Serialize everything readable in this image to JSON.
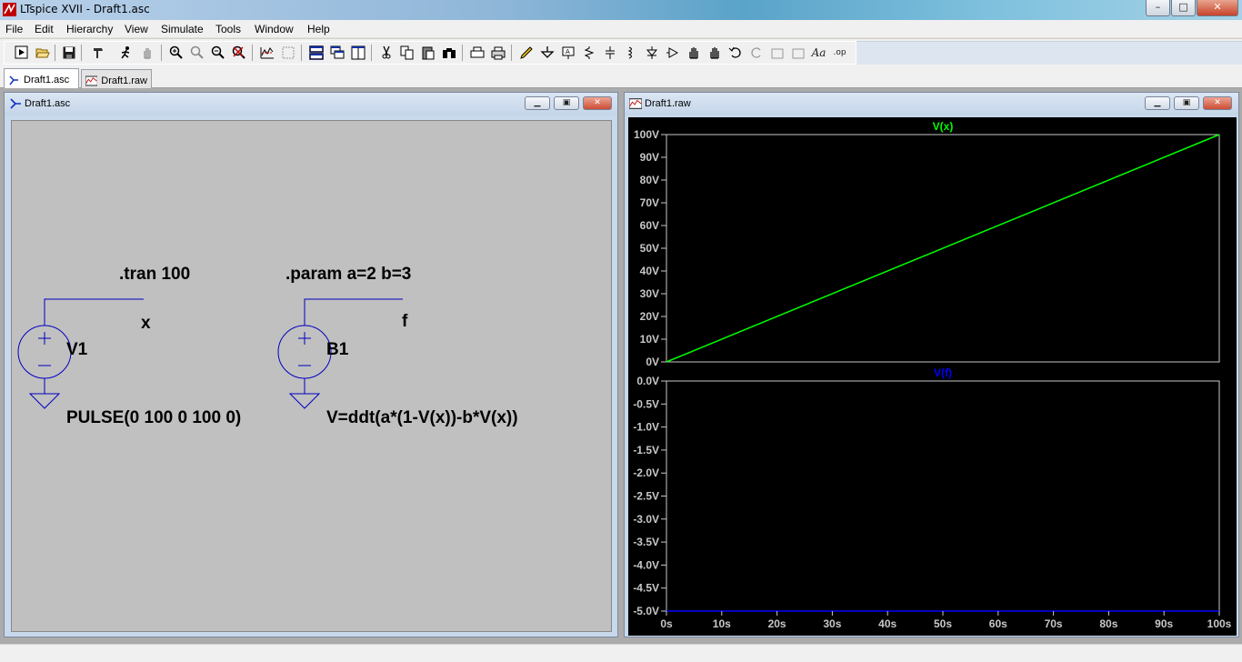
{
  "window": {
    "title": "LTspice XVII - Draft1.asc",
    "min": "–",
    "max": "□",
    "close": "✕"
  },
  "menu": [
    "File",
    "Edit",
    "Hierarchy",
    "View",
    "Simulate",
    "Tools",
    "Window",
    "Help"
  ],
  "tabs": [
    {
      "label": "Draft1.asc",
      "icon": "schematic-icon",
      "active": true
    },
    {
      "label": "Draft1.raw",
      "icon": "waveform-icon",
      "active": false
    }
  ],
  "schematic": {
    "title": "Draft1.asc",
    "directives": {
      "tran": ".tran 100",
      "param": ".param a=2 b=3"
    },
    "v1": {
      "name": "V1",
      "value": "PULSE(0 100 0 100 0)",
      "net": "x"
    },
    "b1": {
      "name": "B1",
      "value": "V=ddt(a*(1-V(x))-b*V(x))",
      "net": "f"
    }
  },
  "waveform": {
    "title": "Draft1.raw",
    "colors": {
      "vx": "#00ff00",
      "vf": "#0000ff",
      "axis": "#c8c8c8",
      "text": "#c8c8c8"
    }
  },
  "chart_data": [
    {
      "type": "line",
      "title": "V(x)",
      "xlabel": "",
      "ylabel": "",
      "x": [
        0,
        100
      ],
      "series": [
        {
          "name": "V(x)",
          "values": [
            0,
            100
          ]
        }
      ],
      "xlim": [
        0,
        100
      ],
      "ylim": [
        0,
        100
      ],
      "yticks": [
        "0V",
        "10V",
        "20V",
        "30V",
        "40V",
        "50V",
        "60V",
        "70V",
        "80V",
        "90V",
        "100V"
      ],
      "grid": false
    },
    {
      "type": "line",
      "title": "V(f)",
      "xlabel": "",
      "ylabel": "",
      "x": [
        0,
        100
      ],
      "series": [
        {
          "name": "V(f)",
          "values": [
            -5,
            -5
          ]
        }
      ],
      "xlim": [
        0,
        100
      ],
      "ylim": [
        -5,
        0
      ],
      "yticks": [
        "0.0V",
        "-0.5V",
        "-1.0V",
        "-1.5V",
        "-2.0V",
        "-2.5V",
        "-3.0V",
        "-3.5V",
        "-4.0V",
        "-4.5V",
        "-5.0V"
      ],
      "xticks": [
        "0s",
        "10s",
        "20s",
        "30s",
        "40s",
        "50s",
        "60s",
        "70s",
        "80s",
        "90s",
        "100s"
      ],
      "grid": false
    }
  ]
}
